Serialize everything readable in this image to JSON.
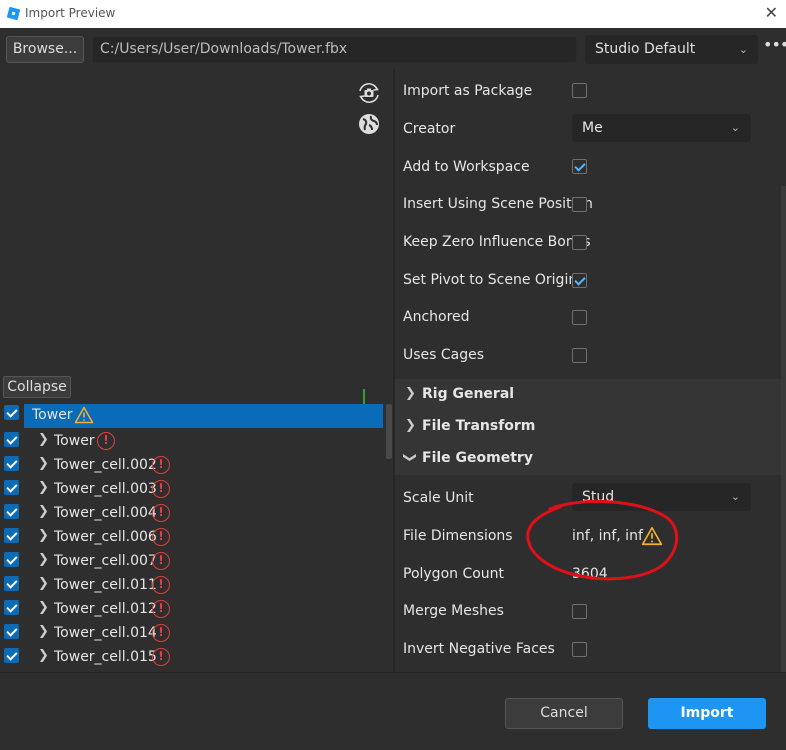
{
  "window": {
    "title": "Import Preview",
    "close_glyph": "✕",
    "logo_color": "#1d95f3"
  },
  "toolbar": {
    "browse_label": "Browse...",
    "file_path": "C:/Users/User/Downloads/Tower.fbx",
    "preset_value": "Studio Default",
    "more_glyph": "•••"
  },
  "viewport": {
    "icons": [
      "rotate-camera-icon",
      "globe-icon",
      "axes-gizmo-icon"
    ]
  },
  "tree": {
    "collapse_label": "Collapse",
    "items": [
      {
        "label": "Tower",
        "checked": true,
        "selected": true,
        "status": "warning",
        "expandable": false
      },
      {
        "label": "Tower",
        "checked": true,
        "selected": false,
        "status": "error",
        "expandable": true
      },
      {
        "label": "Tower_cell.002",
        "checked": true,
        "status": "error",
        "expandable": true
      },
      {
        "label": "Tower_cell.003",
        "checked": true,
        "status": "error",
        "expandable": true
      },
      {
        "label": "Tower_cell.004",
        "checked": true,
        "status": "error",
        "expandable": true
      },
      {
        "label": "Tower_cell.006",
        "checked": true,
        "status": "error",
        "expandable": true
      },
      {
        "label": "Tower_cell.007",
        "checked": true,
        "status": "error",
        "expandable": true
      },
      {
        "label": "Tower_cell.011",
        "checked": true,
        "status": "error",
        "expandable": true
      },
      {
        "label": "Tower_cell.012",
        "checked": true,
        "status": "error",
        "expandable": true
      },
      {
        "label": "Tower_cell.014",
        "checked": true,
        "status": "error",
        "expandable": true
      },
      {
        "label": "Tower_cell.015",
        "checked": true,
        "status": "error",
        "expandable": true
      }
    ],
    "error_glyph": "!"
  },
  "properties": {
    "import_as_package": {
      "label": "Import as Package",
      "checked": false
    },
    "creator": {
      "label": "Creator",
      "value": "Me"
    },
    "add_to_workspace": {
      "label": "Add to Workspace",
      "checked": true
    },
    "insert_using_scene_position": {
      "label": "Insert Using Scene Position",
      "checked": false
    },
    "keep_zero_influence_bones": {
      "label": "Keep Zero Influence Bones",
      "checked": false
    },
    "set_pivot_to_scene_origin": {
      "label": "Set Pivot to Scene Origin",
      "checked": true
    },
    "anchored": {
      "label": "Anchored",
      "checked": false
    },
    "uses_cages": {
      "label": "Uses Cages",
      "checked": false
    },
    "sections": {
      "rig_general": "Rig General",
      "file_transform": "File Transform",
      "file_geometry": "File Geometry"
    },
    "scale_unit": {
      "label": "Scale Unit",
      "value": "Stud"
    },
    "file_dimensions": {
      "label": "File Dimensions",
      "value": "inf, inf, inf"
    },
    "polygon_count": {
      "label": "Polygon Count",
      "value": "3604"
    },
    "merge_meshes": {
      "label": "Merge Meshes",
      "checked": false
    },
    "invert_negative_faces": {
      "label": "Invert Negative Faces",
      "checked": false
    }
  },
  "footer": {
    "cancel_label": "Cancel",
    "import_label": "Import"
  },
  "colors": {
    "accent": "#1d95f3",
    "selected_row": "#0a6bb8",
    "error": "#e0413b",
    "warning": "#f2b134",
    "annotation": "#e0101a"
  }
}
